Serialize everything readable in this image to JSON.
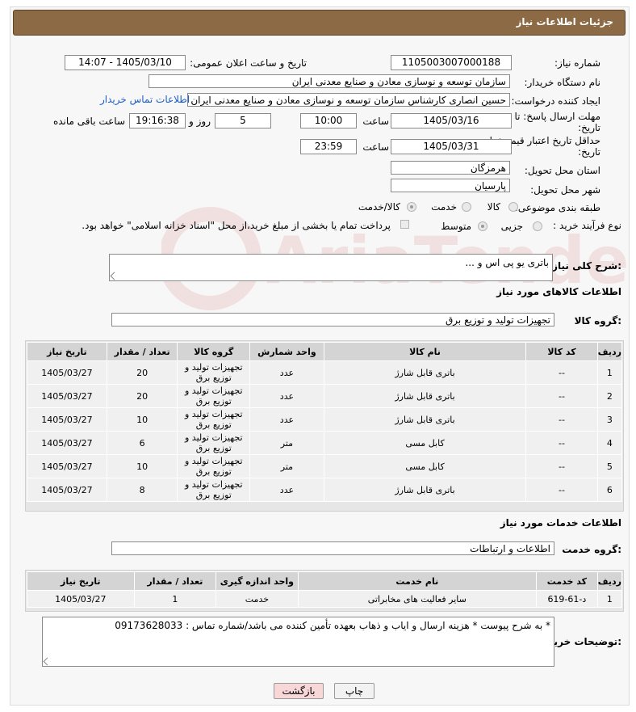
{
  "header": {
    "title": "جزئیات اطلاعات نیاز"
  },
  "fields": {
    "need_number_label": "شماره نیاز:",
    "need_number": "1105003007000188",
    "announce_label": "تاریخ و ساعت اعلان عمومی:",
    "announce_value": "1405/03/10 - 14:07",
    "buyer_org_label": "نام دستگاه خریدار:",
    "buyer_org": "سازمان توسعه و نوسازی معادن و صنایع معدنی ایران",
    "requester_label": "ایجاد کننده درخواست:",
    "requester": "حسین انصاری کارشناس سازمان توسعه و نوسازی معادن و صنایع معدنی ایران",
    "buyer_contact_link": "اطلاعات تماس خریدار",
    "deadline_label": "مهلت ارسال پاسخ: تا تاریخ:",
    "deadline_date": "1405/03/16",
    "time_label": "ساعت",
    "deadline_time": "10:00",
    "days_value": "5",
    "days_label": "روز و",
    "remaining_time": "19:16:38",
    "remaining_label": "ساعت باقی مانده",
    "price_validity_label": "حداقل تاریخ اعتبار قیمت: تا تاریخ:",
    "price_validity_date": "1405/03/31",
    "price_validity_time": "23:59",
    "province_label": "استان محل تحویل:",
    "province": "هرمزگان",
    "city_label": "شهر محل تحویل:",
    "city": "پارسیان",
    "category_label": "طبقه بندی موضوعی:",
    "category_options": [
      "کالا",
      "خدمت",
      "کالا/خدمت"
    ],
    "category_selected": "کالا/خدمت",
    "process_label": "نوع فرآیند خرید :",
    "process_options": [
      "جزیی",
      "متوسط"
    ],
    "process_selected": "متوسط",
    "payment_note": "پرداخت تمام یا بخشی از مبلغ خرید،از محل \"اسناد خزانه اسلامی\" خواهد بود."
  },
  "description": {
    "label": "شرح کلی نیاز:",
    "value": "باتری یو پی اس و ..."
  },
  "goods_section": {
    "title": "اطلاعات کالاهای مورد نیاز",
    "group_label": "گروه کالا:",
    "group_value": "تجهیزات تولید و توزیع برق",
    "columns": [
      "ردیف",
      "کد کالا",
      "نام کالا",
      "واحد شمارش",
      "گروه کالا",
      "تعداد / مقدار",
      "تاریخ نیاز"
    ],
    "rows": [
      [
        "1",
        "--",
        "باتری قابل شارژ",
        "عدد",
        "تجهیزات تولید و توزیع برق",
        "20",
        "1405/03/27"
      ],
      [
        "2",
        "--",
        "باتری قابل شارژ",
        "عدد",
        "تجهیزات تولید و توزیع برق",
        "20",
        "1405/03/27"
      ],
      [
        "3",
        "--",
        "باتری قابل شارژ",
        "عدد",
        "تجهیزات تولید و توزیع برق",
        "10",
        "1405/03/27"
      ],
      [
        "4",
        "--",
        "کابل مسی",
        "متر",
        "تجهیزات تولید و توزیع برق",
        "6",
        "1405/03/27"
      ],
      [
        "5",
        "--",
        "کابل مسی",
        "متر",
        "تجهیزات تولید و توزیع برق",
        "10",
        "1405/03/27"
      ],
      [
        "6",
        "--",
        "باتری قابل شارژ",
        "عدد",
        "تجهیزات تولید و توزیع برق",
        "8",
        "1405/03/27"
      ]
    ]
  },
  "services_section": {
    "title": "اطلاعات خدمات مورد نیاز",
    "group_label": "گروه خدمت:",
    "group_value": "اطلاعات و ارتباطات",
    "columns": [
      "ردیف",
      "کد خدمت",
      "نام خدمت",
      "واحد اندازه گیری",
      "تعداد / مقدار",
      "تاریخ نیاز"
    ],
    "rows": [
      [
        "1",
        "د-61-619",
        "سایر فعالیت های مخابراتی",
        "خدمت",
        "1",
        "1405/03/27"
      ]
    ]
  },
  "buyer_notes": {
    "label": "توضیحات خریدار:",
    "value": "* به شرح پیوست * هزینه ارسال و ایاب و ذهاب بعهده تأمین کننده می باشد/شماره تماس : 09173628033"
  },
  "buttons": {
    "print": "چاپ",
    "back": "بازگشت"
  },
  "colors": {
    "header": "#8c6a45",
    "link": "#1a5ec8",
    "back_button": "#f7d7d7"
  }
}
